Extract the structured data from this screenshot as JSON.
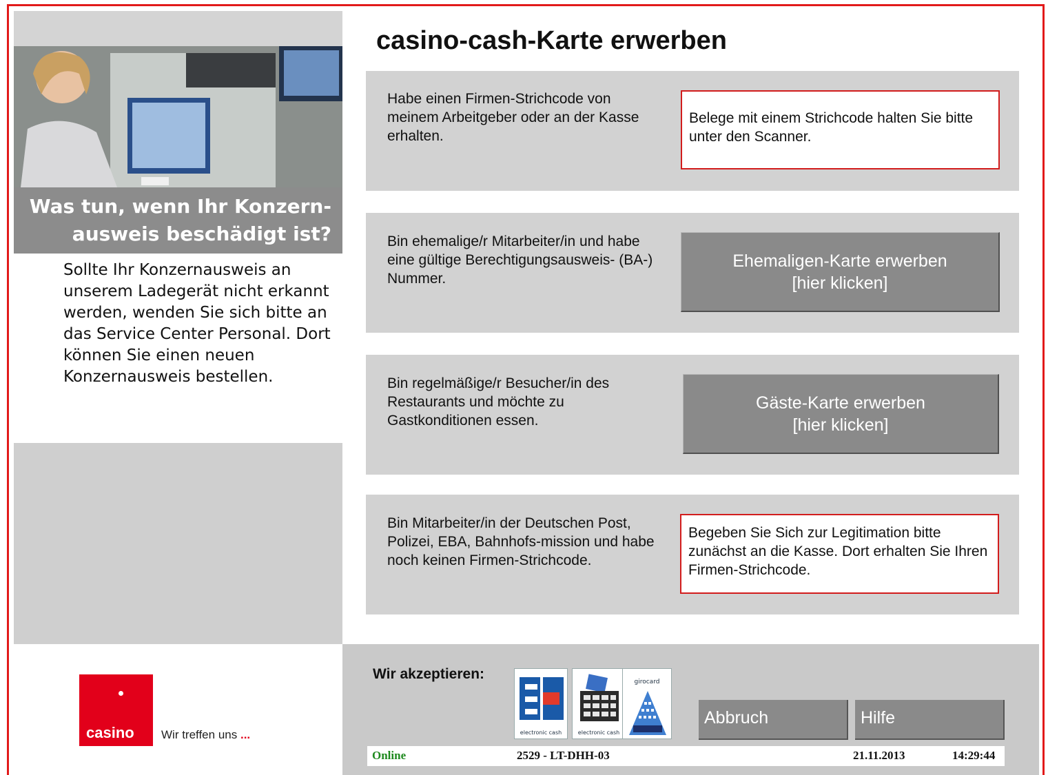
{
  "title": "casino-cash-Karte erwerben",
  "left": {
    "heading": "Was tun, wenn Ihr Konzern-\nausweis beschädigt ist?",
    "info": "Sollte Ihr Konzernausweis an unserem Ladegerät nicht erkannt werden, wenden Sie sich bitte an das Service Center Personal. Dort können Sie einen neuen Konzernausweis bestellen."
  },
  "options": [
    {
      "text": "Habe einen Firmen-Strichcode von meinem Arbeitgeber oder an der Kasse erhalten.",
      "notice": "Belege mit einem Strichcode halten Sie bitte unter den Scanner."
    },
    {
      "text": "Bin ehemalige/r Mitarbeiter/in und habe eine gültige Berechtigungsausweis- (BA-) Nummer.",
      "button_line1": "Ehemaligen-Karte erwerben",
      "button_line2": "[hier klicken]"
    },
    {
      "text": "Bin regelmäßige/r Besucher/in des Restaurants und möchte zu Gastkonditionen essen.",
      "button_line1": "Gäste-Karte erwerben",
      "button_line2": "[hier klicken]"
    },
    {
      "text": "Bin Mitarbeiter/in der Deutschen Post, Polizei, EBA, Bahnhofs-mission und habe noch keinen Firmen-Strichcode.",
      "notice": "Begeben Sie Sich zur Legitimation bitte zunächst an die Kasse. Dort erhalten Sie Ihren Firmen-Strichcode."
    }
  ],
  "footer": {
    "accept_label": "Wir akzeptieren:",
    "cards": [
      {
        "caption": "electronic cash"
      },
      {
        "caption": "electronic cash"
      },
      {
        "caption": "girocard"
      }
    ],
    "cancel_label": "Abbruch",
    "help_label": "Hilfe"
  },
  "brand": {
    "logo_text": "casino",
    "tagline": "Wir treffen uns",
    "tagline_suffix": "...",
    "color": "#e2001a"
  },
  "status": {
    "connection": "Online",
    "terminal_id": "2529 - LT-DHH-03",
    "date": "21.11.2013",
    "time": "14:29:44",
    "online_color": "#1f8a1f"
  }
}
